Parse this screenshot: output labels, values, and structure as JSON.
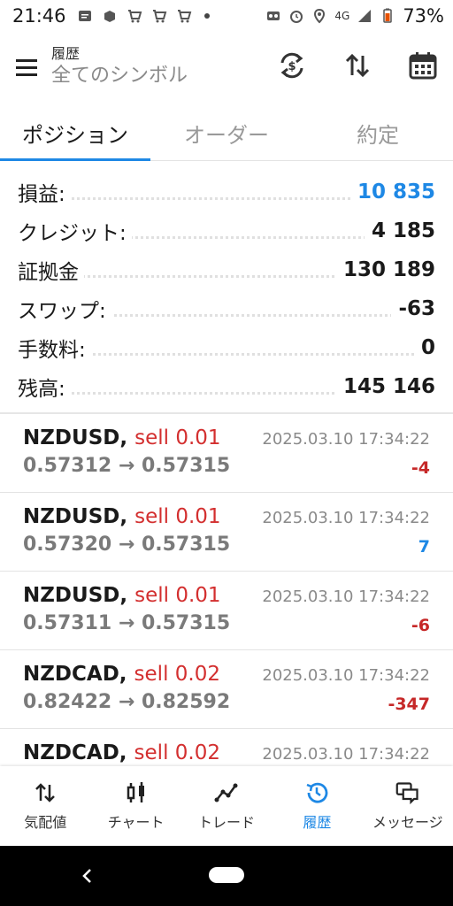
{
  "status_bar": {
    "time": "21:46",
    "network": "4G",
    "battery": "73%",
    "left_icons": [
      "message-icon",
      "app-icon",
      "cart-icon",
      "cart-icon",
      "cart-icon",
      "dot-icon"
    ],
    "right_icons": [
      "voicemail-icon",
      "alarm-icon",
      "location-icon",
      "signal-icon",
      "battery-icon"
    ]
  },
  "app_bar": {
    "title": "履歴",
    "subtitle": "全てのシンボル",
    "icons": [
      "menu-icon",
      "currency-exchange-icon",
      "sort-icon",
      "calendar-icon"
    ]
  },
  "tabs": [
    {
      "label": "ポジション",
      "active": true
    },
    {
      "label": "オーダー",
      "active": false
    },
    {
      "label": "約定",
      "active": false
    }
  ],
  "summary": [
    {
      "label": "損益:",
      "value": "10 835",
      "color": "#1e88e5"
    },
    {
      "label": "クレジット:",
      "value": "4 185"
    },
    {
      "label": "証拠金",
      "value": "130 189"
    },
    {
      "label": "スワップ:",
      "value": "-63"
    },
    {
      "label": "手数料:",
      "value": "0"
    },
    {
      "label": "残高:",
      "value": "145 146"
    }
  ],
  "positions": [
    {
      "symbol": "NZDUSD,",
      "side": "sell 0.01",
      "time": "2025.03.10 17:34:22",
      "prices": "0.57312 → 0.57315",
      "profit": "-4",
      "sign": "neg"
    },
    {
      "symbol": "NZDUSD,",
      "side": "sell 0.01",
      "time": "2025.03.10 17:34:22",
      "prices": "0.57320 → 0.57315",
      "profit": "7",
      "sign": "pos"
    },
    {
      "symbol": "NZDUSD,",
      "side": "sell 0.01",
      "time": "2025.03.10 17:34:22",
      "prices": "0.57311 → 0.57315",
      "profit": "-6",
      "sign": "neg"
    },
    {
      "symbol": "NZDCAD,",
      "side": "sell 0.02",
      "time": "2025.03.10 17:34:22",
      "prices": "0.82422 → 0.82592",
      "profit": "-347",
      "sign": "neg"
    },
    {
      "symbol": "NZDCAD,",
      "side": "sell 0.02",
      "time": "2025.03.10 17:34:22",
      "prices": "",
      "profit": "",
      "sign": "neg"
    }
  ],
  "bottom_nav": [
    {
      "label": "気配値",
      "icon": "quotes-icon",
      "active": false
    },
    {
      "label": "チャート",
      "icon": "chart-icon",
      "active": false
    },
    {
      "label": "トレード",
      "icon": "trade-icon",
      "active": false
    },
    {
      "label": "履歴",
      "icon": "history-icon",
      "active": true
    },
    {
      "label": "メッセージ",
      "icon": "messages-icon",
      "active": false
    }
  ],
  "colors": {
    "accent": "#1e88e5",
    "negative": "#c62828",
    "sell": "#d32f2f"
  }
}
